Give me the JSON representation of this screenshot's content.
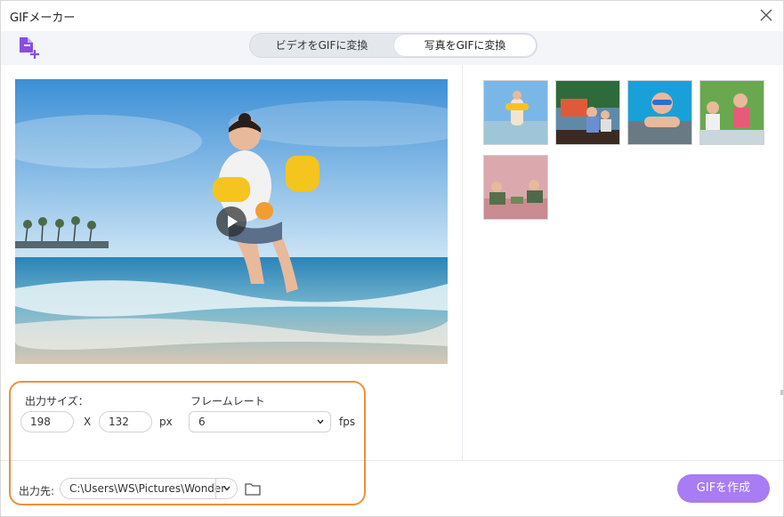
{
  "window": {
    "title": "GIFメーカー"
  },
  "icons": {
    "close": "close-icon",
    "add_file": "add-file-icon",
    "play": "play-icon",
    "folder": "folder-icon",
    "dropdown": "chevron-down-icon"
  },
  "tabs": [
    {
      "label": "ビデオをGIFに変換",
      "selected": false
    },
    {
      "label": "写真をGIFに変換",
      "selected": true
    }
  ],
  "thumbnails": [
    {
      "name": "thumb-girl-beach-floaties",
      "selected": true
    },
    {
      "name": "thumb-kids-playground",
      "selected": false
    },
    {
      "name": "thumb-girl-swimming-goggles",
      "selected": false
    },
    {
      "name": "thumb-kids-pool-edge",
      "selected": false
    },
    {
      "name": "thumb-kids-pink-room",
      "selected": false
    }
  ],
  "settings": {
    "size_label": "出力サイズ：",
    "width": "198",
    "times": "X",
    "height": "132",
    "unit_px": "px",
    "framerate_label": "フレームレート",
    "framerate": "6",
    "unit_fps": "fps",
    "output_label": "出力先:",
    "output_path": "C:\\Users\\WS\\Pictures\\Wonder"
  },
  "actions": {
    "create": "GIFを作成"
  },
  "colors": {
    "accent": "#a87cf2",
    "highlight_ring": "#f0903a",
    "add_icon": "#8a4de0"
  }
}
